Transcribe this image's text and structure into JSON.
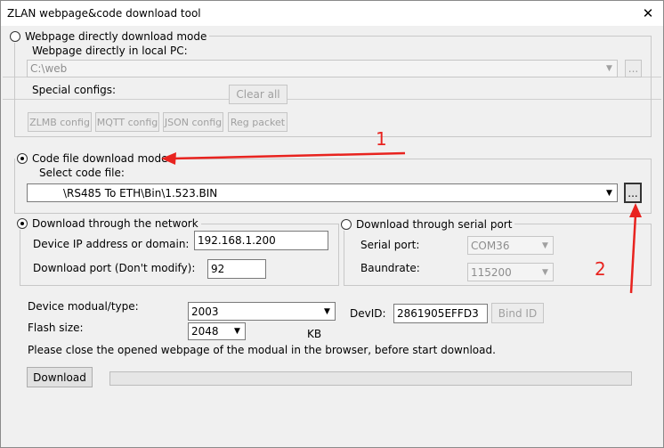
{
  "window": {
    "title": "ZLAN webpage&code download tool",
    "close_glyph": "✕"
  },
  "webpage_mode": {
    "label": "Webpage directly download mode",
    "path_label": "Webpage directly in local PC:",
    "path_value": "C:\\web",
    "browse_label": "...",
    "special_label": "Special configs:",
    "clear_all": "Clear all",
    "buttons": [
      "ZLMB config",
      "MQTT config",
      "JSON config",
      "Reg packet"
    ]
  },
  "code_mode": {
    "label": "Code file download mode",
    "select_label": "Select code file:",
    "file_value": "\\RS485 To ETH\\Bin\\1.523.BIN",
    "browse_label": "..."
  },
  "network": {
    "label": "Download through the network",
    "ip_label": "Device IP address or domain:",
    "ip_value": "192.168.1.200",
    "port_label": "Download port (Don't modify):",
    "port_value": "92"
  },
  "serial": {
    "label": "Download through serial port",
    "port_label": "Serial port:",
    "port_value": "COM36",
    "baud_label": "Baundrate:",
    "baud_value": "115200"
  },
  "device": {
    "type_label": "Device modual/type:",
    "type_value": "2003",
    "flash_label": "Flash size:",
    "flash_value": "2048",
    "flash_unit": "KB",
    "devid_label": "DevID:",
    "devid_value": "2861905EFFD3",
    "bind_label": "Bind ID"
  },
  "notice": "Please close the opened webpage of the modual in the browser, before start download.",
  "download_label": "Download",
  "annotations": {
    "one": "1",
    "two": "2",
    "color": "#e8231f"
  }
}
